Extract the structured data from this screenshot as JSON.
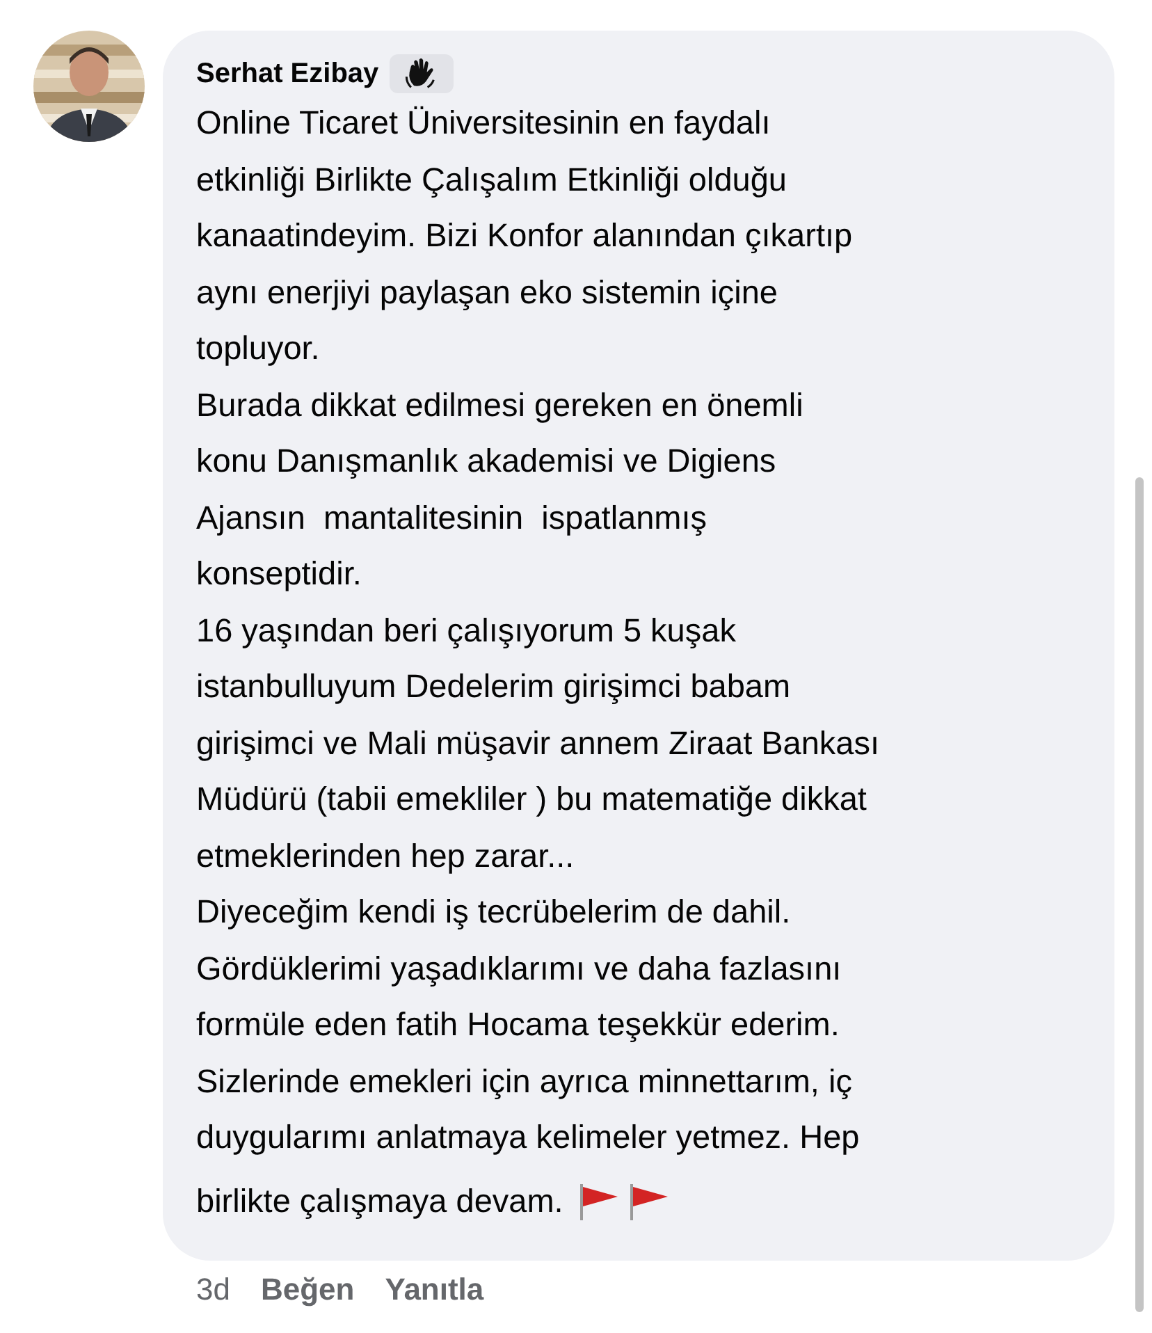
{
  "comment": {
    "author": "Serhat Ezibay",
    "lines": [
      "Online Ticaret Üniversitesinin en faydalı",
      "etkinliği Birlikte Çalışalım Etkinliği olduğu",
      "kanaatindeyim. Bizi Konfor alanından çıkartıp",
      "aynı enerjiyi paylaşan eko sistemin içine",
      "topluyor.",
      "Burada dikkat edilmesi gereken en önemli",
      "konu Danışmanlık akademisi ve Digiens",
      "Ajansın  mantalitesinin  ispatlanmış",
      "konseptidir.",
      "16 yaşından beri çalışıyorum 5 kuşak",
      "istanbulluyum Dedelerim girişimci babam",
      "girişimci ve Mali müşavir annem Ziraat Bankası",
      "Müdürü (tabii emekliler ) bu matematiğe dikkat",
      "etmeklerinden hep zarar...",
      "Diyeceğim kendi iş tecrübelerim de dahil.",
      "Gördüklerimi yaşadıklarımı ve daha fazlasını",
      "formüle eden fatih Hocama teşekkür ederim.",
      "Sizlerinde emekleri için ayrıca minnettarım, iç",
      "duygularımı anlatmaya kelimeler yetmez. Hep",
      "birlikte çalışmaya devam."
    ],
    "time": "3d",
    "actions": [
      "Beğen",
      "Yanıtla"
    ]
  }
}
